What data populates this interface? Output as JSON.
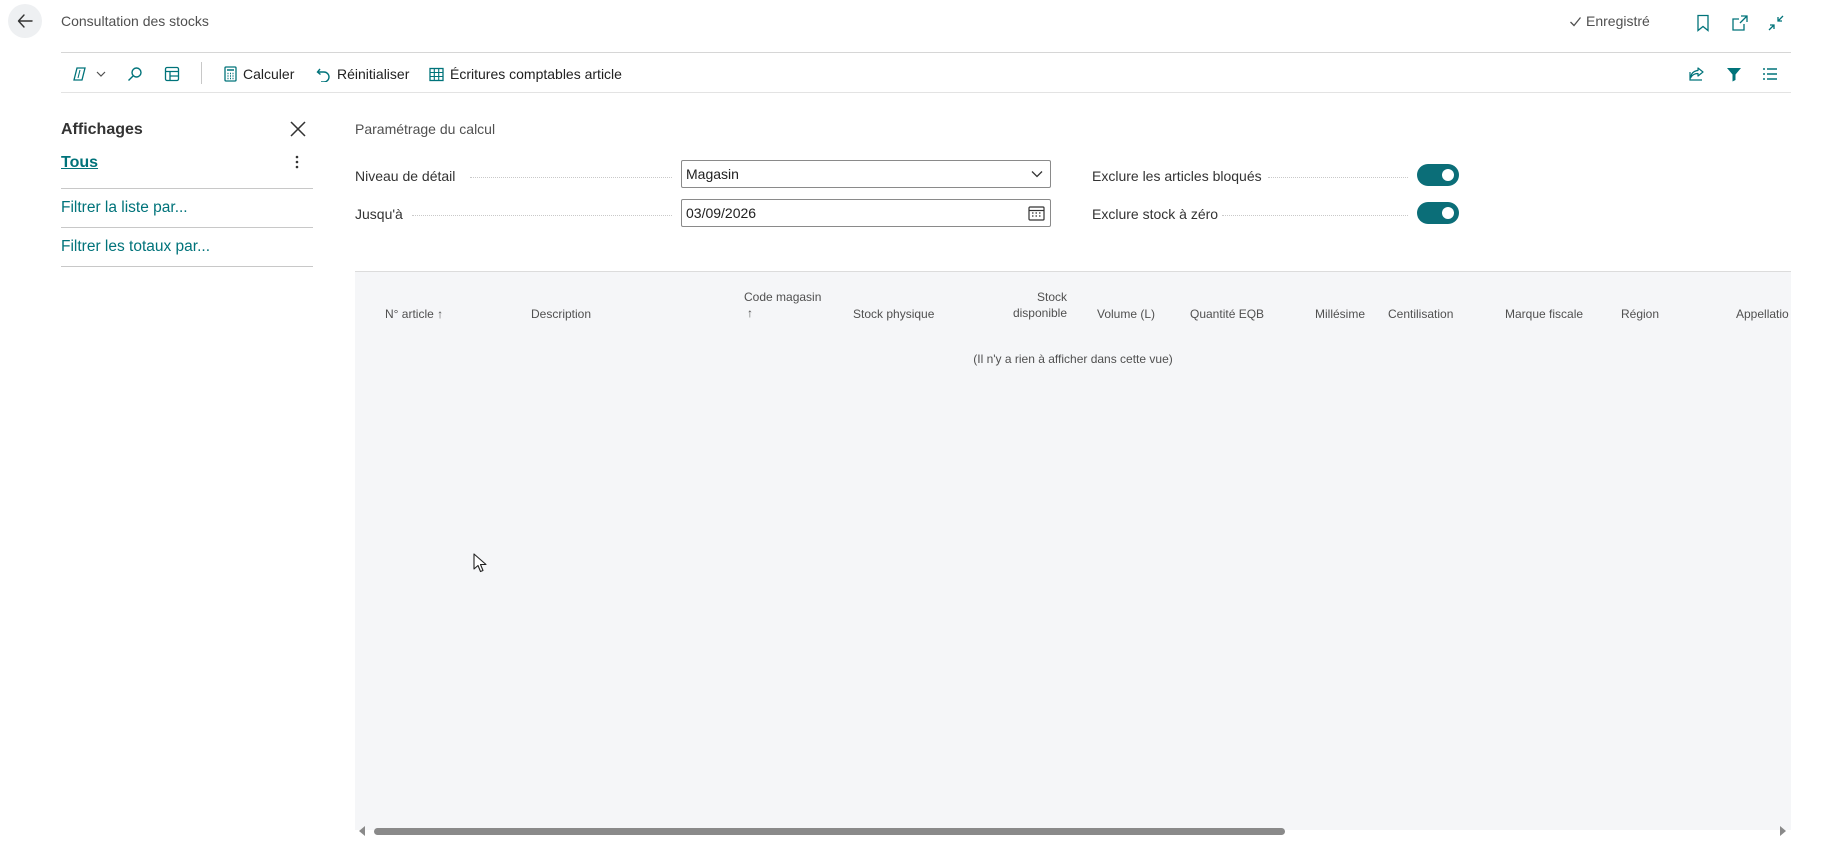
{
  "header": {
    "title": "Consultation des stocks",
    "saved_status": "Enregistré"
  },
  "actions": {
    "calculate": "Calculer",
    "reset": "Réinitialiser",
    "ledger_entries": "Écritures comptables article"
  },
  "views": {
    "title": "Affichages",
    "all": "Tous",
    "filter_list": "Filtrer la liste par...",
    "filter_totals": "Filtrer les totaux par..."
  },
  "params": {
    "title": "Paramétrage du calcul",
    "detail_level_label": "Niveau de détail",
    "detail_level_value": "Magasin",
    "until_label": "Jusqu'à",
    "until_value": "03/09/2026",
    "exclude_blocked_label": "Exclure les articles bloqués",
    "exclude_blocked_on": true,
    "exclude_zero_label": "Exclure stock à zéro",
    "exclude_zero_on": true
  },
  "grid": {
    "columns": [
      {
        "label": "N° article ↑"
      },
      {
        "label": "Description"
      },
      {
        "label": "Code magasin",
        "sub": "↑"
      },
      {
        "label": "Stock physique"
      },
      {
        "label": "Stock",
        "sub": "disponible"
      },
      {
        "label": "Volume (L)"
      },
      {
        "label": "Quantité EQB"
      },
      {
        "label": "Millésime"
      },
      {
        "label": "Centilisation"
      },
      {
        "label": "Marque fiscale"
      },
      {
        "label": "Région"
      },
      {
        "label": "Appellatio"
      }
    ],
    "empty_message": "(Il n'y a rien à afficher dans cette vue)"
  },
  "colors": {
    "accent": "#00737a",
    "toggle_on": "#0b6e78"
  }
}
